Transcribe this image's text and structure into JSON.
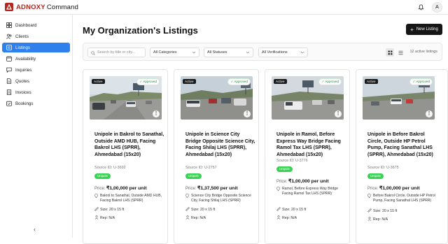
{
  "brand": {
    "name_part1": "ADNOXY",
    "name_part2": "Command",
    "accent_color": "#b3261e"
  },
  "user": {
    "avatar_initial": "A"
  },
  "sidebar": {
    "items": [
      {
        "label": "Dashboard",
        "icon": "dashboard-icon",
        "active": false
      },
      {
        "label": "Clients",
        "icon": "users-icon",
        "active": false
      },
      {
        "label": "Listings",
        "icon": "listings-icon",
        "active": true
      },
      {
        "label": "Availability",
        "icon": "calendar-icon",
        "active": false
      },
      {
        "label": "Inquiries",
        "icon": "chat-icon",
        "active": false
      },
      {
        "label": "Quotes",
        "icon": "document-icon",
        "active": false
      },
      {
        "label": "Invoices",
        "icon": "receipt-icon",
        "active": false
      },
      {
        "label": "Bookings",
        "icon": "bookings-icon",
        "active": false
      }
    ],
    "collapse_glyph": "‹"
  },
  "page": {
    "title": "My Organization's Listings",
    "new_button": "New Listing"
  },
  "filters": {
    "search_placeholder": "Search by title or city...",
    "categories": "All Categories",
    "statuses": "All Statuses",
    "verifications": "All Verifications",
    "count_text": "12 active listings"
  },
  "listings": [
    {
      "status": "Active",
      "approval": "Approved",
      "title": "Unipole in Bakrol to Sanathal, Outside AMD HUB, Facing Bakrol LHS (SPRR), Ahmedabad (15x20)",
      "source_id": "Source ID: U-3692",
      "type": "Unipole",
      "price_label": "Price:",
      "price": "₹1,00,000 per unit",
      "location": "Bakrol to Sanathal, Outside AMD HUB, Facing Bakrol LHS (SPRR)",
      "size": "Size: 20 x 15 ft",
      "rep": "Rep: N/A"
    },
    {
      "status": "Active",
      "approval": "Approved",
      "title": "Unipole in Science City Bridge Opposite Science City, Facing Shilaj LHS (SPRR), Ahmedabad (15x20)",
      "source_id": "Source ID: U-2757",
      "type": "Unipole",
      "price_label": "Price:",
      "price": "₹1,37,500 per unit",
      "location": "Science City Bridge Opposite Science City, Facing Shilaj LHS (SPRR)",
      "size": "Size: 20 x 15 ft",
      "rep": "Rep: N/A"
    },
    {
      "status": "Active",
      "approval": "Approved",
      "title": "Unipole in Ramol, Before Express Way Bridge Facing Ramol Tax LHS (SPRR), Ahmedabad (15x20)",
      "source_id": "Source ID: U-3776",
      "type": "Unipole",
      "price_label": "Price:",
      "price": "₹1,00,000 per unit",
      "location": "Ramol, Before Express Way Bridge Facing Ramol Tax LHS (SPRR)",
      "size": "Size: 20 x 15 ft",
      "rep": "Rep: N/A"
    },
    {
      "status": "Active",
      "approval": "Approved",
      "title": "Unipole in Before Bakrol Circle, Outside HP Petrol Pump, Facing Sanathal LHS (SPRR), Ahmedabad (15x20)",
      "source_id": "Source ID: U-3675",
      "type": "Unipole",
      "price_label": "Price:",
      "price": "₹1,00,000 per unit",
      "location": "Before Bakrol Circle, Outside HP Petrol Pump, Facing Sanathal LHS (SPRR)",
      "size": "Size: 20 x 15 ft",
      "rep": "Rep: N/A"
    }
  ]
}
